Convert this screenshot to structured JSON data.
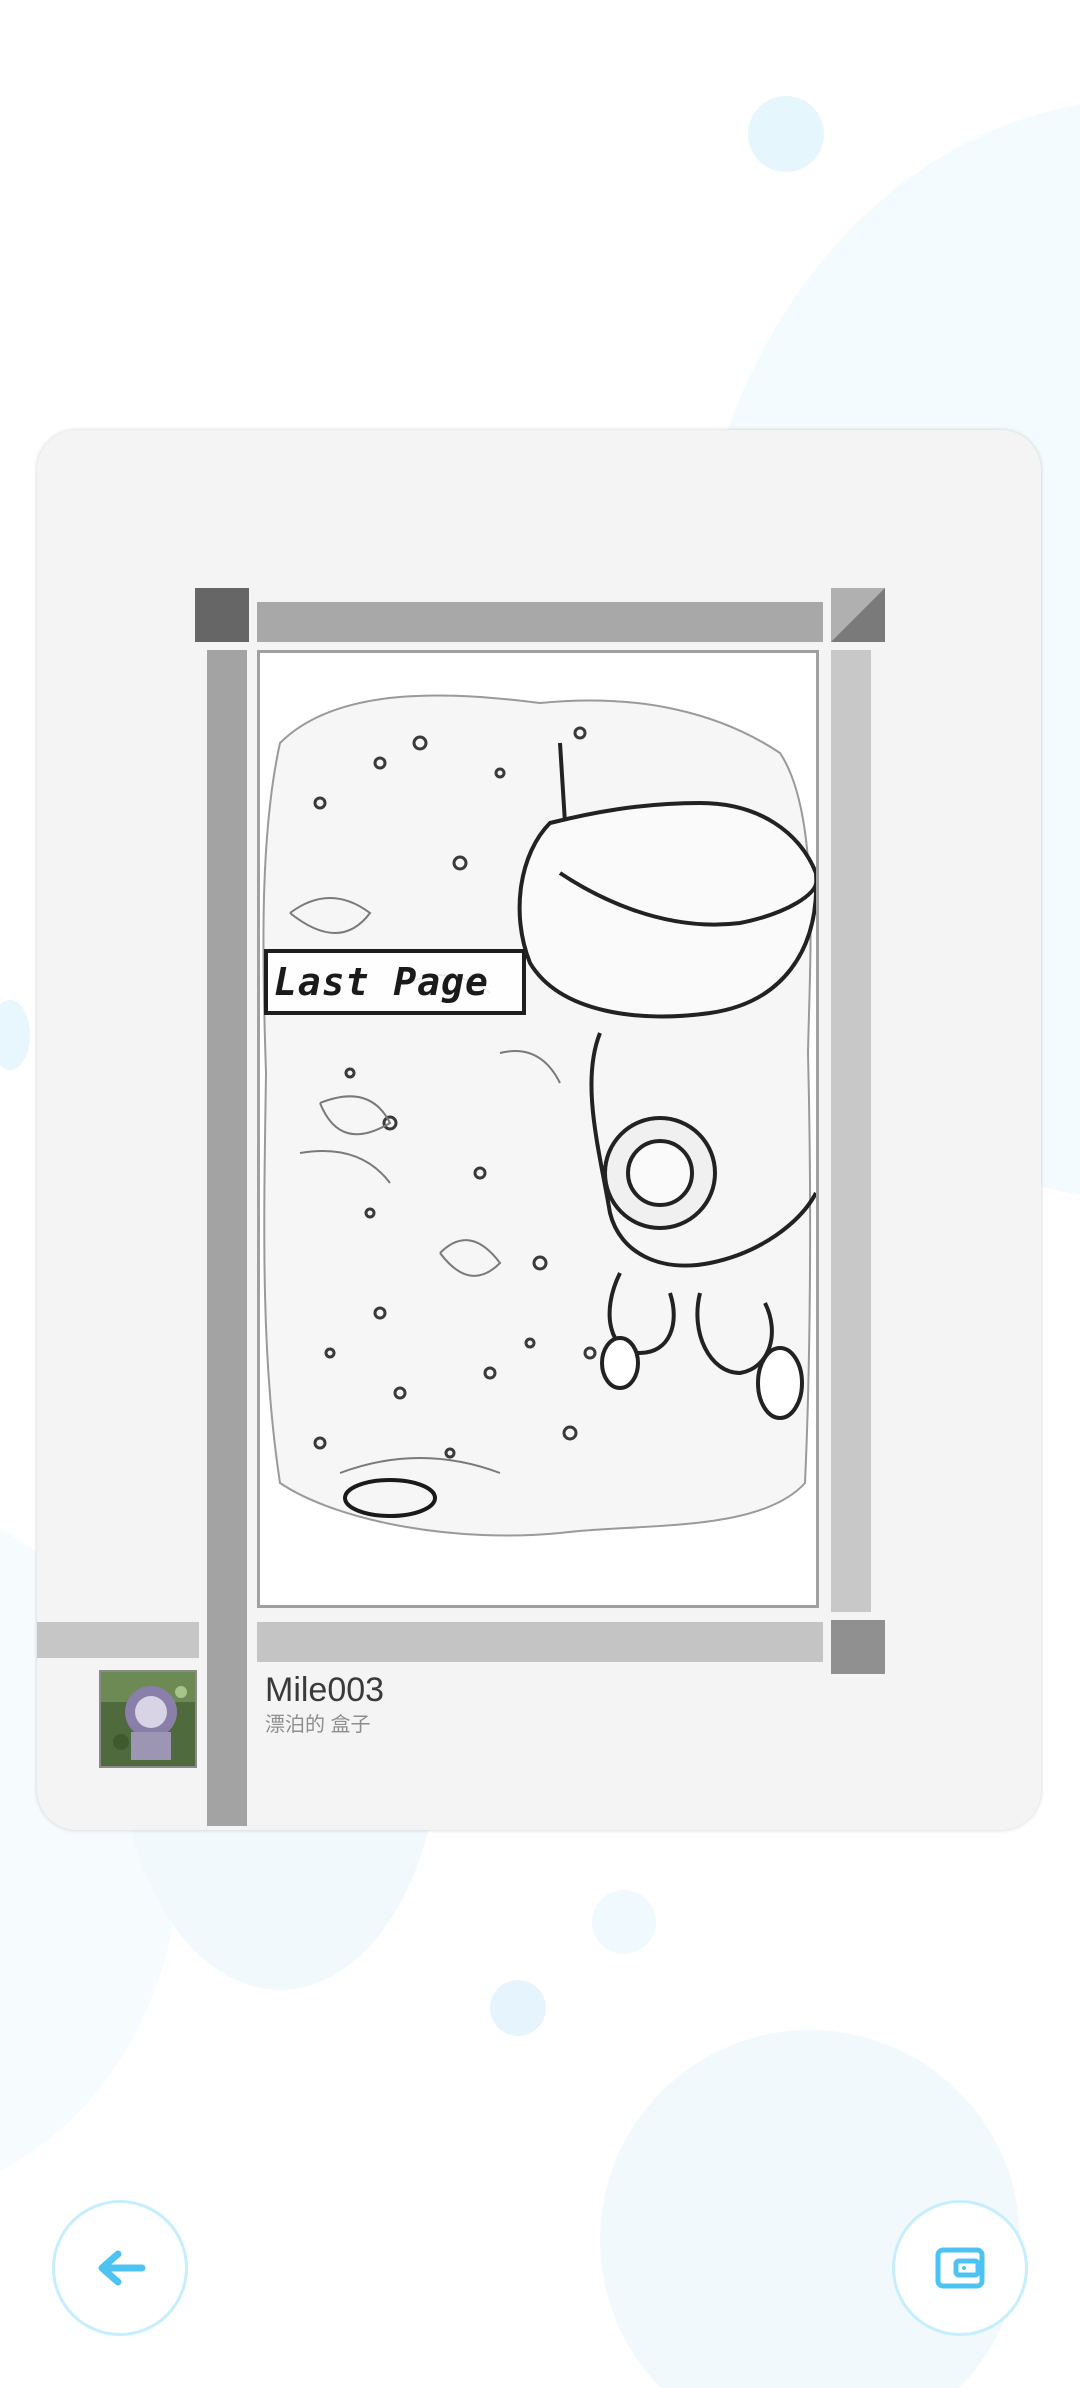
{
  "cover": {
    "label": "Last Page"
  },
  "book": {
    "title": "Mile003",
    "subtitle": "漂泊的 盒子"
  },
  "buttons": {
    "back_icon": "arrow-left-icon",
    "wallet_icon": "wallet-icon"
  },
  "colors": {
    "accent": "#4cc3f1",
    "accent_light": "#c7eefc",
    "card_bg": "#f4f4f4"
  }
}
